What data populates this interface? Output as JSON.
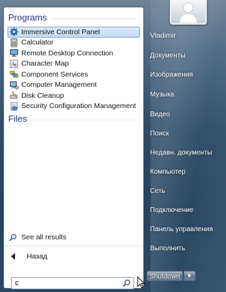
{
  "programs_section": {
    "header": "Programs",
    "items": [
      {
        "label": "Immersive Control Panel",
        "icon": "gear-icon",
        "selected": true
      },
      {
        "label": "Calculator",
        "icon": "calculator-icon",
        "selected": false
      },
      {
        "label": "Remote Desktop Connection",
        "icon": "remote-desktop-icon",
        "selected": false
      },
      {
        "label": "Character Map",
        "icon": "character-map-icon",
        "selected": false
      },
      {
        "label": "Component Services",
        "icon": "component-services-icon",
        "selected": false
      },
      {
        "label": "Computer Management",
        "icon": "computer-management-icon",
        "selected": false
      },
      {
        "label": "Disk Cleanup",
        "icon": "disk-cleanup-icon",
        "selected": false
      },
      {
        "label": "Security Configuration Management",
        "icon": "security-config-icon",
        "selected": false
      }
    ]
  },
  "files_section": {
    "header": "Files"
  },
  "see_all": {
    "label": "See all results",
    "icon": "search-icon"
  },
  "back": {
    "label": "Назад",
    "icon": "back-arrow-icon"
  },
  "search": {
    "value": "c",
    "icon": "search-icon"
  },
  "user": {
    "name": "Vladimir",
    "avatar_icon": "user-avatar-icon"
  },
  "right_links": [
    "Документы",
    "Изображения",
    "Музыка",
    "Видео",
    "Поиск",
    "Недавн. документы",
    "Компьютер",
    "Сеть",
    "Подключение",
    "Панель управления",
    "Выполнить"
  ],
  "shutdown": {
    "label": "Shutdown",
    "arrow_icon": "chevron-right-icon"
  },
  "colors": {
    "header_text": "#1e3287",
    "selection_bg": "#c5dcf5",
    "selection_border": "#7da2ce",
    "right_pane_text": "#ffffff"
  }
}
